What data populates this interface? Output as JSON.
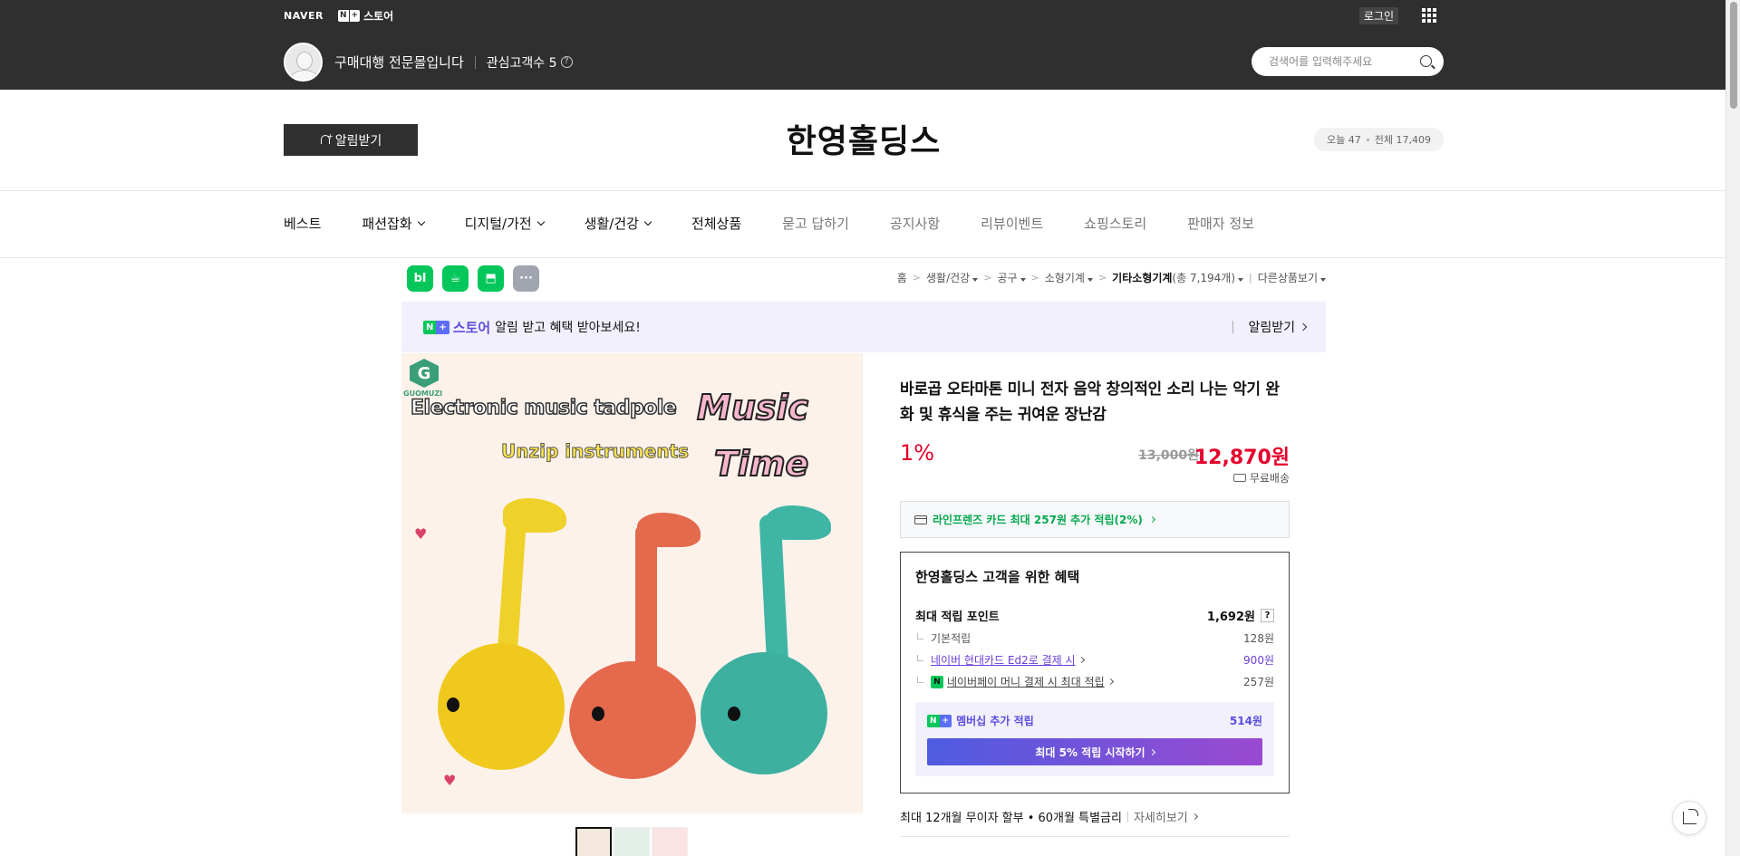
{
  "gnb": {
    "naver_logo": "NAVER",
    "store_badge_n": "N",
    "store_badge_plus": "+",
    "store_label": "스토어",
    "login": "로그인"
  },
  "seller": {
    "name": "구매대행 전문몰입니다",
    "followers": "관심고객수 5",
    "help": "?"
  },
  "search": {
    "placeholder": "검색어를 입력해주세요"
  },
  "store": {
    "alarm_button": "알림받기",
    "title": "한영홀딩스",
    "visitors_today": "오늘 47",
    "visitors_total": "전체 17,409"
  },
  "categories": [
    {
      "label": "베스트",
      "dropdown": false,
      "style": "dark"
    },
    {
      "label": "패션잡화",
      "dropdown": true,
      "style": "dark"
    },
    {
      "label": "디지털/가전",
      "dropdown": true,
      "style": "dark"
    },
    {
      "label": "생활/건강",
      "dropdown": true,
      "style": "dark"
    },
    {
      "label": "전체상품",
      "dropdown": false,
      "style": "dark"
    },
    {
      "label": "묻고 답하기",
      "dropdown": false,
      "style": "light"
    },
    {
      "label": "공지사항",
      "dropdown": false,
      "style": "light"
    },
    {
      "label": "리뷰이벤트",
      "dropdown": false,
      "style": "light"
    },
    {
      "label": "쇼핑스토리",
      "dropdown": false,
      "style": "light"
    },
    {
      "label": "판매자 정보",
      "dropdown": false,
      "style": "light"
    }
  ],
  "sns": [
    {
      "label": "bl",
      "icon": "blog-icon"
    },
    {
      "label": "☕",
      "icon": "talk-icon"
    },
    {
      "label": "⬒",
      "icon": "bookmark-icon"
    },
    {
      "label": "···",
      "icon": "more-icon"
    }
  ],
  "breadcrumb": {
    "home": "홈",
    "c1": "생활/건강",
    "c2": "공구",
    "c3": "소형기계",
    "c4": "기타소형기계",
    "c4_count": "(총 7,194개)",
    "other": "다른상품보기"
  },
  "banner": {
    "badge_n": "N",
    "badge_plus": "+",
    "store_word": "스토어",
    "message": "알림 받고 혜택 받아보세요!",
    "action": "알림받기"
  },
  "image_text": {
    "brand": "GUOMUZI",
    "line1": "Electronic music tadpole",
    "line2": "Unzip instruments",
    "music": "Music",
    "time": "Time"
  },
  "product": {
    "title": "바로곱 오타마톤 미니 전자 음악 창의적인 소리 나는 악기 완화 및 휴식을 주는 귀여운 장난감",
    "discount": "1%",
    "original_price": "13,000원",
    "sale_price": "12,870원",
    "shipping": "무료배송",
    "card_benefit": "라인프렌즈 카드 최대 257원 추가 적립(2%)"
  },
  "benefit": {
    "title": "한영홀딩스 고객을 위한 혜택",
    "max_label": "최대 적립 포인트",
    "max_value": "1,692원",
    "basic_label": "기본적립",
    "basic_value": "128원",
    "card_label": "네이버 현대카드 Ed2로 결제 시",
    "card_value": "900원",
    "pay_label": "네이버페이 머니 결제 시 최대 적립",
    "pay_value": "257원",
    "member_label": "멤버십 추가 적립",
    "member_value": "514원",
    "member_button": "최대 5% 적립 시작하기"
  },
  "installment": {
    "text": "최대 12개월 무이자 할부 • 60개월 특별금리",
    "more": "자세히보기"
  },
  "colors": {
    "header_bg": "#2f2f2f",
    "naver_green": "#03c75a",
    "price_red": "#e4002b",
    "membership_purple": "#5c4dde"
  }
}
